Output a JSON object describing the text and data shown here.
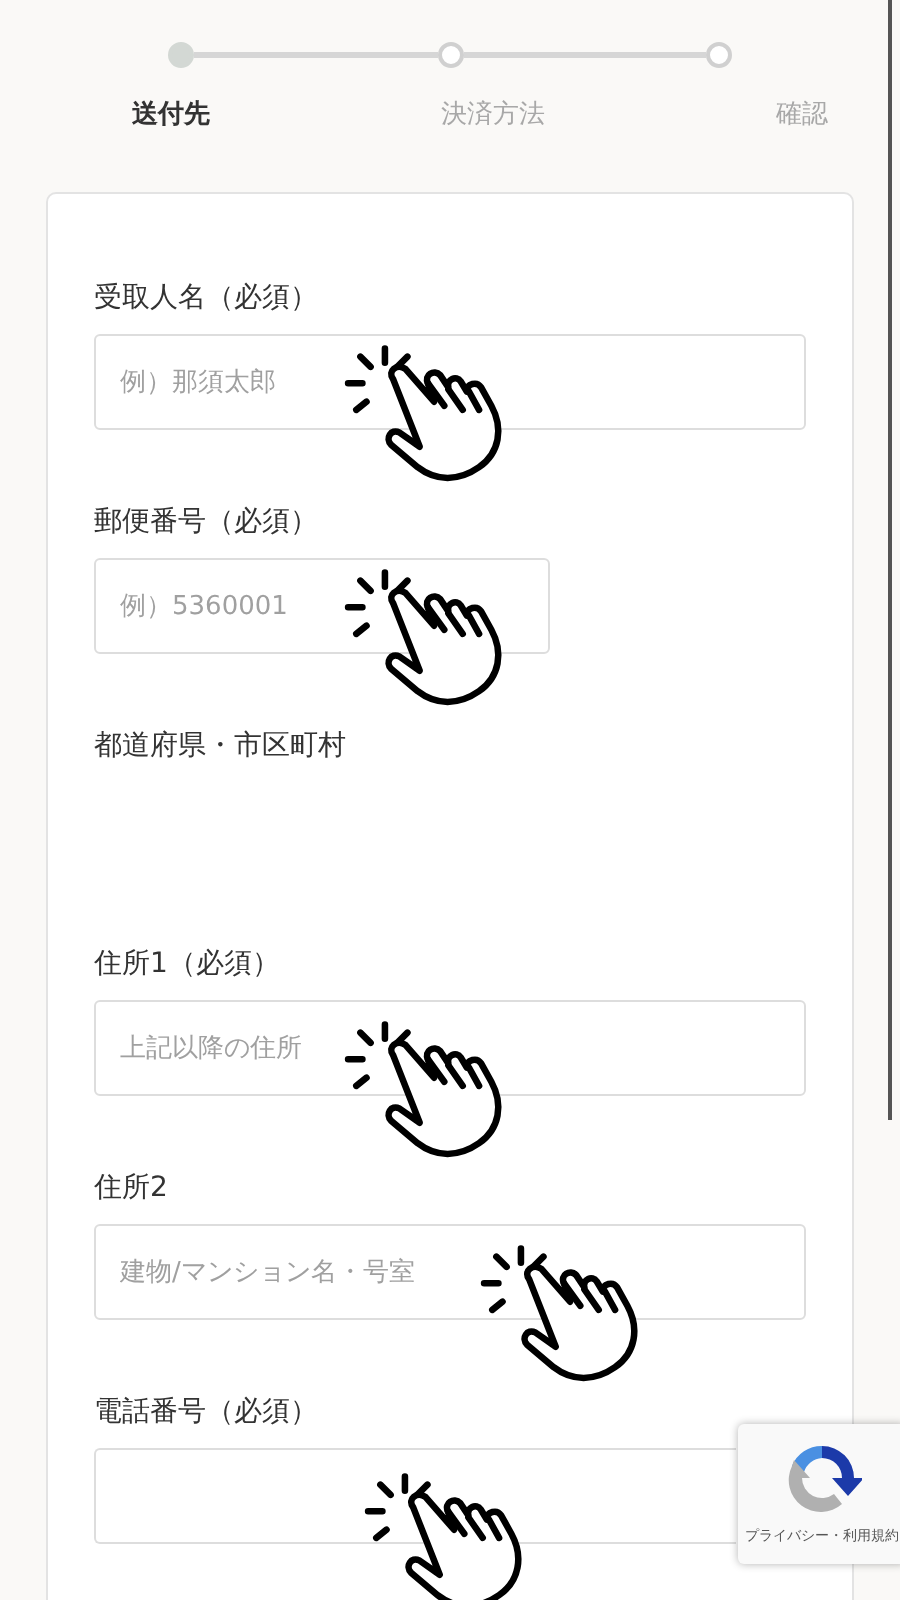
{
  "steps": [
    {
      "label": "送付先",
      "selected": true
    },
    {
      "label": "決済方法",
      "selected": false
    },
    {
      "label": "確認",
      "selected": false
    }
  ],
  "fields": [
    {
      "kind": "input",
      "label": "受取人名（必須）",
      "placeholder": "例）那須太郎"
    },
    {
      "kind": "short-input",
      "label": "郵便番号（必須）",
      "placeholder": "例）5360001"
    },
    {
      "kind": "static",
      "label": "都道府県・市区町村"
    },
    {
      "kind": "input",
      "label": "住所1（必須）",
      "placeholder": "上記以降の住所"
    },
    {
      "kind": "input",
      "label": "住所2",
      "placeholder": "建物/マンション名・号室"
    },
    {
      "kind": "input",
      "label": "電話番号（必須）"
    }
  ],
  "recaptcha": {
    "text": "プライバシー・利用規約"
  }
}
